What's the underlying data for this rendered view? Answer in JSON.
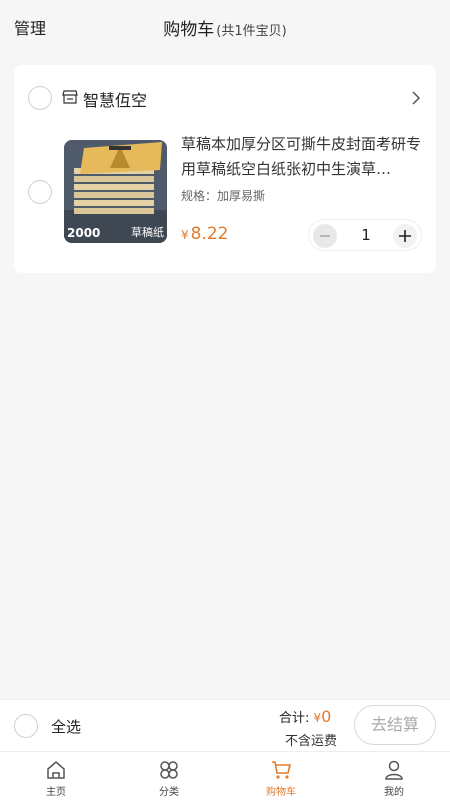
{
  "header": {
    "manage_label": "管理",
    "title": "购物车",
    "count_text": "(共1件宝贝)"
  },
  "store": {
    "name": "智慧仾空",
    "icon": "store-icon"
  },
  "item": {
    "title": "草稿本加厚分区可撕牛皮封面考研专用草稿纸空白纸张初中生演草…",
    "spec": "规格：加厚易撕",
    "currency": "¥",
    "price": "8.22",
    "quantity": "1",
    "thumb_number": "2000",
    "thumb_tag": "草稿纸"
  },
  "checkout": {
    "select_all_label": "全选",
    "total_label": "合计:",
    "currency": "¥",
    "total_value": "0",
    "shipping_note": "不含运费",
    "checkout_label": "去结算"
  },
  "tabs": [
    {
      "label": "主页",
      "icon": "home-icon"
    },
    {
      "label": "分类",
      "icon": "category-icon"
    },
    {
      "label": "购物车",
      "icon": "cart-icon",
      "active": true
    },
    {
      "label": "我的",
      "icon": "user-icon"
    }
  ],
  "colors": {
    "accent": "#e47a2a",
    "background": "#f6f6f6"
  }
}
